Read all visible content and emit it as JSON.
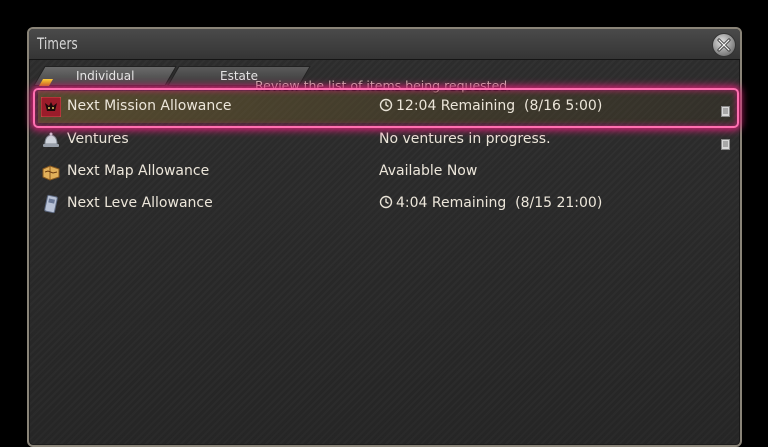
{
  "window": {
    "title": "Timers"
  },
  "tabs": [
    {
      "label": "Individual",
      "selected": true
    },
    {
      "label": "Estate",
      "selected": false
    }
  ],
  "tooltip": "Review the list of items being requested.",
  "rows": [
    {
      "label": "Next Mission Allowance",
      "status": "12:04 Remaining  (8/16 5:00)",
      "icon": "mission-icon",
      "has_clock": true,
      "has_doc": true,
      "selected": true
    },
    {
      "label": "Ventures",
      "status": "No ventures in progress.",
      "icon": "bell-icon",
      "has_clock": false,
      "has_doc": true,
      "selected": false
    },
    {
      "label": "Next Map Allowance",
      "status": "Available Now",
      "icon": "map-icon",
      "has_clock": false,
      "has_doc": false,
      "selected": false
    },
    {
      "label": "Next Leve Allowance",
      "status": "4:04 Remaining  (8/15 21:00)",
      "icon": "leve-card-icon",
      "has_clock": true,
      "has_doc": false,
      "selected": false
    }
  ],
  "colors": {
    "highlight": "#ff4fa0",
    "selected_row": "#6e5c30",
    "tab_marker": "#ffc81e"
  }
}
